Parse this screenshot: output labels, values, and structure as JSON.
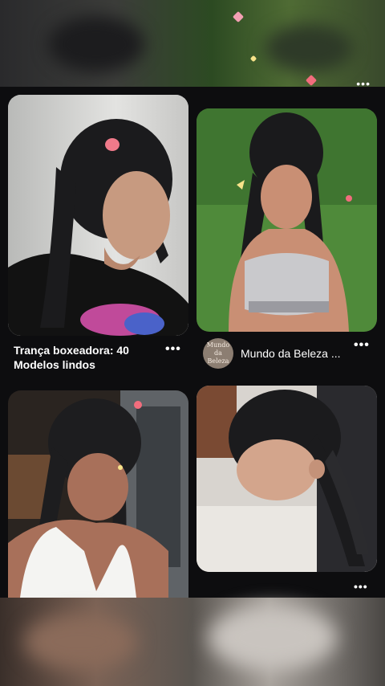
{
  "pins": [
    {
      "title": "Trança boxeadora: 40 Modelos lindos",
      "more_label": "•••"
    },
    {
      "source_name": "Mundo da Beleza ...",
      "avatar_text": "Mundo da Beleza",
      "more_label": "•••"
    },
    {
      "more_label": ""
    },
    {
      "more_label": "•••"
    }
  ],
  "top_more_label": "•••",
  "colors": {
    "background": "#101012",
    "text": "#ffffff",
    "accent_heart": "#f26d7d"
  }
}
